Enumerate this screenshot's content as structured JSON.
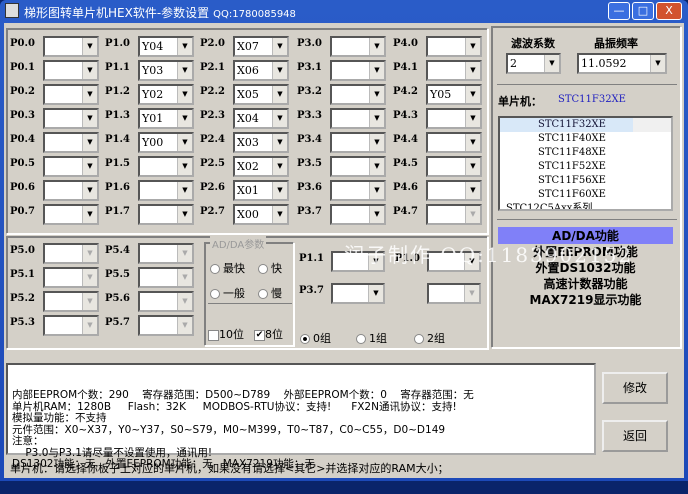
{
  "window": {
    "title": "梯形图转单片机HEX软件-参数设置",
    "qq": "QQ:1780085948",
    "minimize": "—",
    "maximize": "□",
    "close": "X"
  },
  "ports": [
    {
      "label": "P0.0",
      "value": ""
    },
    {
      "label": "P0.1",
      "value": ""
    },
    {
      "label": "P0.2",
      "value": ""
    },
    {
      "label": "P0.3",
      "value": ""
    },
    {
      "label": "P0.4",
      "value": ""
    },
    {
      "label": "P0.5",
      "value": ""
    },
    {
      "label": "P0.6",
      "value": ""
    },
    {
      "label": "P0.7",
      "value": ""
    },
    {
      "label": "P1.0",
      "value": "Y04"
    },
    {
      "label": "P1.1",
      "value": "Y03"
    },
    {
      "label": "P1.2",
      "value": "Y02"
    },
    {
      "label": "P1.3",
      "value": "Y01"
    },
    {
      "label": "P1.4",
      "value": "Y00"
    },
    {
      "label": "P1.5",
      "value": ""
    },
    {
      "label": "P1.6",
      "value": ""
    },
    {
      "label": "P1.7",
      "value": ""
    },
    {
      "label": "P2.0",
      "value": "X07"
    },
    {
      "label": "P2.1",
      "value": "X06"
    },
    {
      "label": "P2.2",
      "value": "X05"
    },
    {
      "label": "P2.3",
      "value": "X04"
    },
    {
      "label": "P2.4",
      "value": "X03"
    },
    {
      "label": "P2.5",
      "value": "X02"
    },
    {
      "label": "P2.6",
      "value": "X01"
    },
    {
      "label": "P2.7",
      "value": "X00"
    },
    {
      "label": "P3.0",
      "value": ""
    },
    {
      "label": "P3.1",
      "value": ""
    },
    {
      "label": "P3.2",
      "value": ""
    },
    {
      "label": "P3.3",
      "value": ""
    },
    {
      "label": "P3.4",
      "value": ""
    },
    {
      "label": "P3.5",
      "value": ""
    },
    {
      "label": "P3.6",
      "value": ""
    },
    {
      "label": "P3.7",
      "value": ""
    },
    {
      "label": "P4.0",
      "value": ""
    },
    {
      "label": "P4.1",
      "value": ""
    },
    {
      "label": "P4.2",
      "value": "Y05"
    },
    {
      "label": "P4.3",
      "value": ""
    },
    {
      "label": "P4.4",
      "value": ""
    },
    {
      "label": "P4.5",
      "value": ""
    },
    {
      "label": "P4.6",
      "value": ""
    },
    {
      "label": "P4.7",
      "value": "",
      "disabled": true
    }
  ],
  "p5": [
    {
      "label": "P5.0"
    },
    {
      "label": "P5.1"
    },
    {
      "label": "P5.2"
    },
    {
      "label": "P5.3"
    },
    {
      "label": "P5.4"
    },
    {
      "label": "P5.5"
    },
    {
      "label": "P5.6"
    },
    {
      "label": "P5.7"
    }
  ],
  "adda": {
    "title": "AD/DA参数",
    "speeds": [
      "最快",
      "快",
      "一般",
      "慢"
    ],
    "bits10": "10位",
    "bits8": "8位",
    "bits8_checked": true
  },
  "extra": {
    "p11": "P1.1",
    "p10": "P1.0",
    "p37": "P3.7",
    "groups": [
      "0组",
      "1组",
      "2组"
    ],
    "selected_group": 0
  },
  "right": {
    "filter_label": "滤波系数",
    "filter_value": "2",
    "crystal_label": "晶振频率",
    "crystal_value": "11.0592",
    "mcu_label": "单片机：",
    "mcu_value": "STC11F32XE",
    "tree": [
      "STC11F32XE",
      "STC11F40XE",
      "STC11F48XE",
      "STC11F52XE",
      "STC11F56XE",
      "STC11F60XE",
      "STC12C5Axx系列"
    ],
    "features": [
      "AD/DA功能",
      "外置EEPROM功能",
      "外置DS1032功能",
      "高速计数器功能",
      "MAX7219显示功能"
    ],
    "feature_highlight": "#8080f8"
  },
  "info": [
    "内部EEPROM个数：290    寄存器范围：D500~D789    外部EEPROM个数：0    寄存器范围：无",
    "单片机RAM：1280B     Flash：32K     MODBOS-RTU协议：支持!      FX2N通讯协议：支持!",
    "模拟量功能：不支持",
    "元件范围：X0~X37，Y0~Y37，S0~S79，M0~M399，T0~T87，C0~C55，D0~D149",
    "注意：",
    "    P3.0与P3.1请尽量不设置使用，通讯用!",
    "DS1302功能：无   外置EEPROM功能：无   MAX7219功能：无"
  ],
  "buttons": {
    "modify": "修改",
    "back": "返回"
  },
  "status": "单片机：请选择你板子上对应的单片机，如果没有请选择<其它>并选择对应的RAM大小；",
  "watermark": "润子制作  QQ:1183902152"
}
